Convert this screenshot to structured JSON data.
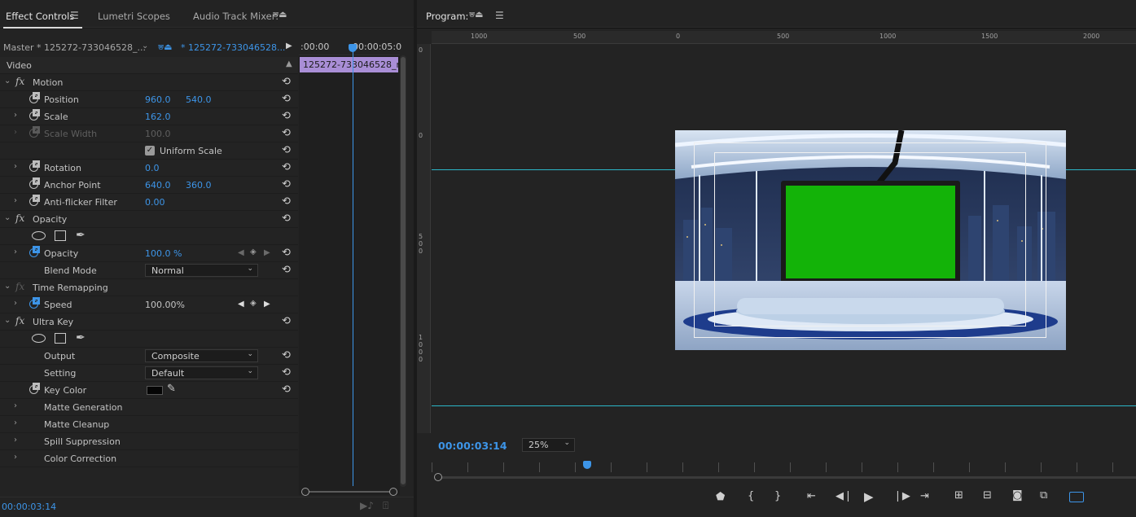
{
  "tabs": {
    "effect_controls": "Effect Controls",
    "lumetri": "Lumetri Scopes",
    "audio_mixer": "Audio Track Mixer:"
  },
  "source": {
    "master": "Master * 125272-733046528_...",
    "clip": "* 125272-733046528...",
    "clip_bar": "125272-733046528_me"
  },
  "timeline_ruler": {
    "start": ":00:00",
    "end": "00:00:05:0"
  },
  "video_label": "Video",
  "motion": {
    "name": "Motion",
    "position_label": "Position",
    "position_x": "960.0",
    "position_y": "540.0",
    "scale_label": "Scale",
    "scale": "162.0",
    "scale_width_label": "Scale Width",
    "scale_width": "100.0",
    "uniform_label": "Uniform Scale",
    "rotation_label": "Rotation",
    "rotation": "0.0",
    "anchor_label": "Anchor Point",
    "anchor_x": "640.0",
    "anchor_y": "360.0",
    "flicker_label": "Anti-flicker Filter",
    "flicker": "0.00"
  },
  "opacity": {
    "name": "Opacity",
    "opacity_label": "Opacity",
    "opacity": "100.0 %",
    "blend_label": "Blend Mode",
    "blend": "Normal"
  },
  "time_remap": {
    "name": "Time Remapping",
    "speed_label": "Speed",
    "speed": "100.00%"
  },
  "ultra_key": {
    "name": "Ultra Key",
    "output_label": "Output",
    "output": "Composite",
    "setting_label": "Setting",
    "setting": "Default",
    "key_color_label": "Key Color",
    "matte_gen": "Matte Generation",
    "matte_cleanup": "Matte Cleanup",
    "spill": "Spill Suppression",
    "color_correction": "Color Correction"
  },
  "left_timecode": "00:00:03:14",
  "program": {
    "title": "Program:",
    "timecode": "00:00:03:14",
    "zoom": "25%",
    "ruler_h": [
      "1000",
      "500",
      "0",
      "500",
      "1000",
      "1500",
      "2000"
    ],
    "ruler_v": [
      "0",
      "0",
      "5\n0\n0",
      "1\n0\n0\n0"
    ]
  },
  "colors": {
    "accent": "#3d95e8",
    "guide": "#2bb6c8",
    "clip": "#a98ed6",
    "key_green": "#13b308"
  }
}
